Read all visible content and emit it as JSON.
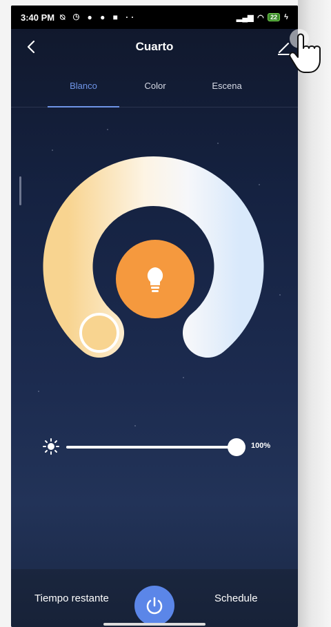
{
  "status_bar": {
    "time": "3:40 PM",
    "icons_left": [
      "mute-icon",
      "alarm-icon",
      "messenger-icon",
      "spotify-icon",
      "video-icon",
      "more-icon"
    ],
    "battery": "22"
  },
  "header": {
    "title": "Cuarto",
    "back_icon": "chevron-left-icon",
    "edit_icon": "pencil-icon"
  },
  "tabs": [
    {
      "label": "Blanco",
      "active": true
    },
    {
      "label": "Color",
      "active": false
    },
    {
      "label": "Escena",
      "active": false
    }
  ],
  "brightness": {
    "label": "100%",
    "value": 1.0
  },
  "bottom": {
    "left_label": "Tiempo restante",
    "right_label": "Schedule",
    "power_icon": "power-icon"
  },
  "colors": {
    "accent": "#6f95e8",
    "center_button": "#f5993e",
    "power_button": "#5b86e8",
    "warm": "#f8d490",
    "cool": "#d9e9fb"
  }
}
